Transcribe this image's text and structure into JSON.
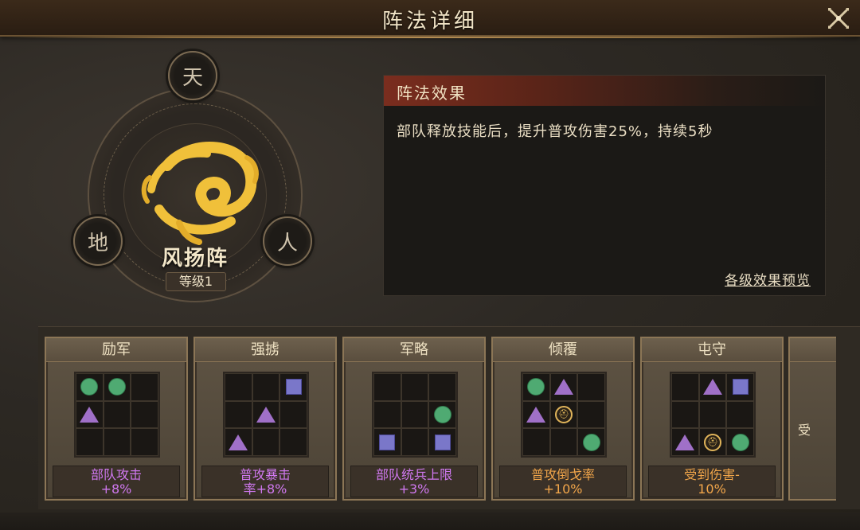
{
  "window": {
    "title": "阵法详细"
  },
  "emblem": {
    "name": "风扬阵",
    "level": "等级1",
    "nodes": [
      "天",
      "地",
      "人"
    ]
  },
  "effect": {
    "header": "阵法效果",
    "description": "部队释放技能后，提升普攻伤害25%，持续5秒",
    "preview_link": "各级效果预览"
  },
  "cards": [
    {
      "title": "励军",
      "effect_line1": "部队攻击",
      "effect_line2": "+8%",
      "effect_color": "purple",
      "grid": [
        "circle",
        "circle",
        "",
        "triangle",
        "",
        "",
        "",
        "",
        ""
      ]
    },
    {
      "title": "强掳",
      "effect_line1": "普攻暴击",
      "effect_line2": "率+8%",
      "effect_color": "purple",
      "grid": [
        "",
        "",
        "square",
        "",
        "triangle",
        "",
        "triangle",
        "",
        ""
      ]
    },
    {
      "title": "军略",
      "effect_line1": "部队统兵上限",
      "effect_line2": "+3%",
      "effect_color": "purple",
      "grid": [
        "",
        "",
        "",
        "",
        "",
        "circle",
        "square",
        "",
        "square"
      ]
    },
    {
      "title": "倾覆",
      "effect_line1": "普攻倒戈率",
      "effect_line2": "+10%",
      "effect_color": "orange",
      "grid": [
        "circle",
        "triangle",
        "",
        "triangle",
        "commander",
        "",
        "",
        "",
        "circle"
      ]
    },
    {
      "title": "屯守",
      "effect_line1": "受到伤害-",
      "effect_line2": "10%",
      "effect_color": "orange",
      "grid": [
        "",
        "triangle",
        "square",
        "",
        "",
        "",
        "triangle",
        "commander",
        "circle"
      ]
    }
  ],
  "partial_card": {
    "text": "受"
  },
  "colors": {
    "circle": "#4faa72",
    "square": "#7a77c9",
    "triangle": "#a070c8",
    "purple_effect": "#d078f0",
    "orange_effect": "#f2a64a",
    "swirl": "#f0c03a"
  }
}
